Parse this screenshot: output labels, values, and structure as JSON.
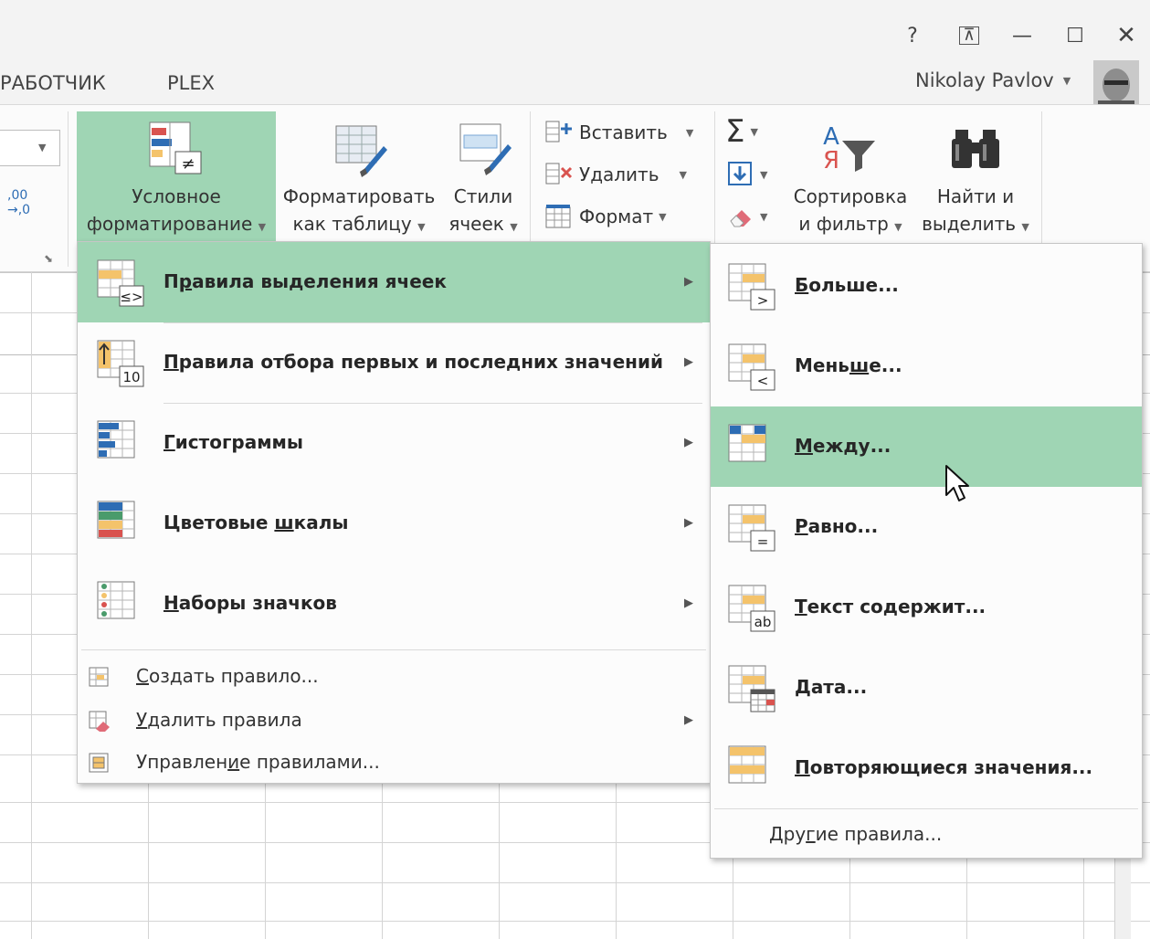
{
  "window": {
    "buttons": [
      {
        "name": "help",
        "symbol": "?"
      },
      {
        "name": "ribbon-display",
        "symbol": "⊼"
      },
      {
        "name": "minimize",
        "symbol": "—"
      },
      {
        "name": "maximize",
        "symbol": "☐"
      },
      {
        "name": "close",
        "symbol": "✕"
      }
    ],
    "tabs": [
      "РАБОТЧИК",
      "PLEX"
    ],
    "user_name": "Nikolay Pavlov"
  },
  "ribbon": {
    "number_format_button": ",00\n→,0",
    "conditional_formatting": [
      "Условное",
      "форматирование"
    ],
    "format_as_table": [
      "Форматировать",
      "как таблицу"
    ],
    "cell_styles": [
      "Стили",
      "ячеек"
    ],
    "cells": {
      "insert": "Вставить",
      "delete": "Удалить",
      "format": "Формат"
    },
    "editing": {
      "autosum_symbol": "Σ",
      "sort_filter": [
        "Сортировка",
        "и фильтр"
      ],
      "find_select": [
        "Найти и",
        "выделить"
      ]
    }
  },
  "main_menu": {
    "items": [
      {
        "id": "highlight-rules",
        "label": "Правила выделения ячеек",
        "mnemonic": "р",
        "icon": "highlight-rules-icon",
        "submenu": true,
        "highlighted": true
      },
      {
        "id": "top-bottom-rules",
        "label": "Правила отбора первых и последних значений",
        "mnemonic": "П",
        "icon": "top-bottom-icon",
        "submenu": true
      },
      {
        "id": "data-bars",
        "label": "Гистограммы",
        "mnemonic": "Г",
        "icon": "data-bars-icon",
        "submenu": true
      },
      {
        "id": "color-scales",
        "label": "Цветовые шкалы",
        "mnemonic": "ш",
        "icon": "color-scales-icon",
        "submenu": true
      },
      {
        "id": "icon-sets",
        "label": "Наборы значков",
        "mnemonic": "Н",
        "icon": "icon-sets-icon",
        "submenu": true
      }
    ],
    "small_items": [
      {
        "id": "new-rule",
        "label": "Создать правило...",
        "mnemonic": "С",
        "icon": "new-rule-icon"
      },
      {
        "id": "clear-rules",
        "label": "Удалить правила",
        "mnemonic": "У",
        "icon": "clear-rules-icon",
        "submenu": true
      },
      {
        "id": "manage-rules",
        "label": "Управление правилами...",
        "mnemonic": "и",
        "icon": "manage-rules-icon"
      }
    ]
  },
  "sub_menu": {
    "items": [
      {
        "id": "greater-than",
        "label": "Больше...",
        "mnemonic": "Б",
        "badge": ">",
        "icon": "greater-than-icon"
      },
      {
        "id": "less-than",
        "label": "Меньше...",
        "mnemonic": "ш",
        "badge": "<",
        "icon": "less-than-icon"
      },
      {
        "id": "between",
        "label": "Между...",
        "mnemonic": "М",
        "badge": "",
        "icon": "between-icon",
        "highlighted": true
      },
      {
        "id": "equal-to",
        "label": "Равно...",
        "mnemonic": "Р",
        "badge": "=",
        "icon": "equal-to-icon"
      },
      {
        "id": "text-contains",
        "label": "Текст содержит...",
        "mnemonic": "Т",
        "badge": "ab",
        "icon": "text-contains-icon"
      },
      {
        "id": "date-occurring",
        "label": "Дата...",
        "mnemonic": "Д",
        "badge": "",
        "icon": "date-icon"
      },
      {
        "id": "duplicate-values",
        "label": "Повторяющиеся значения...",
        "mnemonic": "П",
        "badge": "",
        "icon": "duplicate-values-icon"
      }
    ],
    "more_rules": {
      "label": "Другие правила...",
      "mnemonic": "г"
    }
  },
  "colors": {
    "highlight": "#9fd5b4",
    "ribbon_selected": "#9fd5b4",
    "icon_orange": "#f4c36b",
    "icon_blue": "#2e6db4",
    "icon_red": "#d9534f",
    "icon_green": "#4a9b6b"
  }
}
